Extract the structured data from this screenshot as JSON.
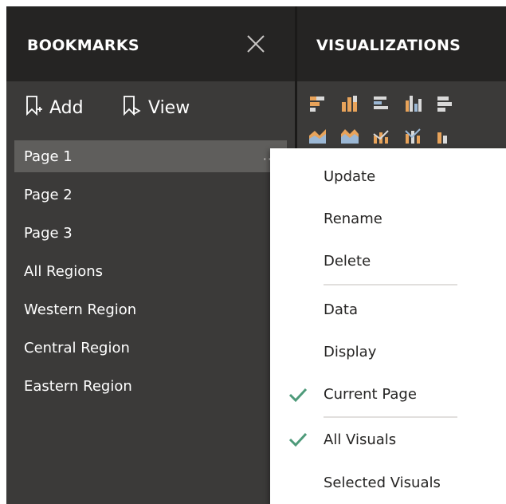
{
  "bookmarks": {
    "title": "BOOKMARKS",
    "close_icon": "close-icon",
    "toolbar": {
      "add_label": "Add",
      "view_label": "View"
    },
    "items": [
      {
        "label": "Page 1",
        "selected": true,
        "more": "···"
      },
      {
        "label": "Page 2"
      },
      {
        "label": "Page 3"
      },
      {
        "label": "All Regions"
      },
      {
        "label": "Western Region"
      },
      {
        "label": "Central Region"
      },
      {
        "label": "Eastern Region"
      }
    ]
  },
  "visualizations": {
    "title": "VISUALIZATIONS"
  },
  "context_menu": {
    "items": [
      {
        "label": "Update"
      },
      {
        "label": "Rename"
      },
      {
        "label": "Delete"
      },
      {
        "label": "Data"
      },
      {
        "label": "Display"
      },
      {
        "label": "Current Page",
        "checked": true
      },
      {
        "label": "All Visuals",
        "checked": true
      },
      {
        "label": "Selected Visuals"
      }
    ]
  },
  "colors": {
    "pane_bg": "#3b3a39",
    "header_bg": "#252423",
    "selected_bg": "#5f5e5c",
    "check_green": "#4e9a7a",
    "chart_orange": "#e8a35a",
    "chart_blue": "#9bb7d4"
  }
}
